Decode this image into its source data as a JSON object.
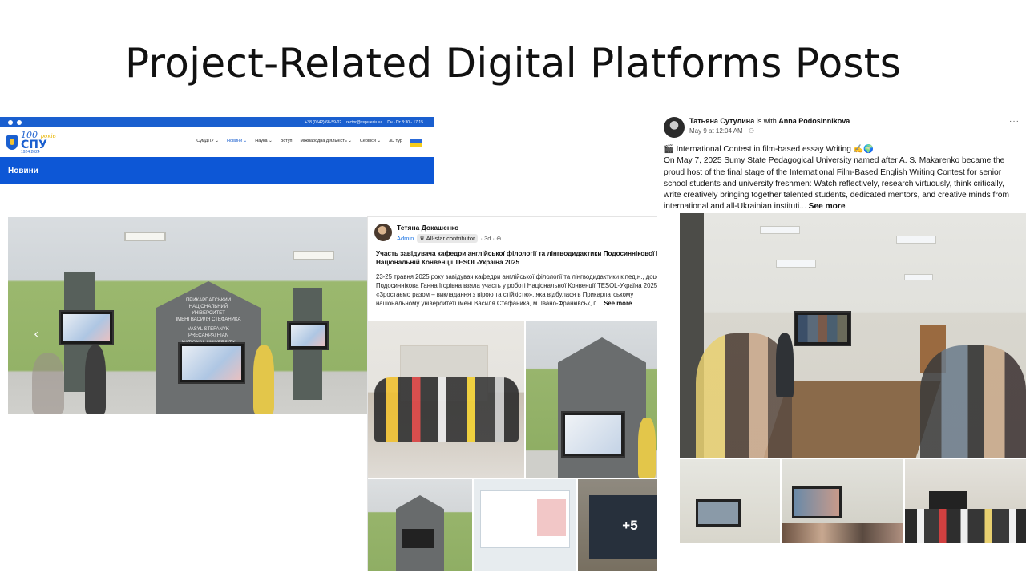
{
  "slide": {
    "title": "Project-Related Digital Platforms Posts"
  },
  "website": {
    "topbar_contacts": [
      "+38 (0542) 68-59-02",
      "rector@sspu.edu.ua",
      "Пн - Пт 8:30 - 17:15"
    ],
    "logo": {
      "hundred": "100",
      "years_word": "років",
      "abbr": "СПУ",
      "years_range": "1924 2024"
    },
    "nav": [
      {
        "label": "СумДПУ ⌄",
        "icon": "building-icon"
      },
      {
        "label": "Новини ⌄",
        "icon": "news-icon"
      },
      {
        "label": "Наука ⌄",
        "icon": "book-icon"
      },
      {
        "label": "Вступ",
        "icon": "person-icon"
      },
      {
        "label": "Міжнародна діяльність ⌄",
        "icon": "flag-icon"
      },
      {
        "label": "Сервіси ⌄",
        "icon": "cloud-icon"
      },
      {
        "label": "3D тур",
        "icon": "eye-icon"
      }
    ],
    "section_band": "Новини"
  },
  "left_photo": {
    "booth_text": [
      "ПРИКАРПАТСЬКИЙ",
      "НАЦІОНАЛЬНИЙ УНІВЕРСИТЕТ",
      "ІМЕНІ ВАСИЛЯ СТЕФАНИКА",
      "VASYL STEFANYK PRECARPATHIAN",
      "NATIONAL UNIVERSITY"
    ],
    "arrow": "‹"
  },
  "post_middle": {
    "author": "Тетяна Докашенко",
    "badge_admin": "Admin",
    "badge_star": "♛ All-star contributor",
    "time": "· 3d · ⊕",
    "more": "···",
    "title": "Участь завідувача кафедри англійської філології та лінгводидактики Подосиннікової Г.І. у Національній Конвенції TESOL-Україна 2025",
    "body": "23-25 травня 2025 року завідувач кафедри англійської філології та лінгводидактики к.пед.н., доцент Подосиннікова Ганна Ігорівна взяла участь у роботі Національної Конвенції TESOL-Україна 2025 «Зростаємо разом – викладання з вірою та стійкістю», яка відбулася в Прикарпатському національному університеті імені Василя Стефаника, м. Івано-Франківськ, п...",
    "see_more": "See more",
    "more_photos": "+5"
  },
  "post_right": {
    "author": "Татьяна Сутулина",
    "with_word": "is with",
    "tagged": "Anna Podosinnikova",
    "time": "May 9 at 12:04 AM · ⚇",
    "more": "···",
    "line1": "🎬 International Contest in film-based essay Writing ✍🌍",
    "body": "On May 7, 2025 Sumy State Pedagogical University named after A. S. Makarenko became the proud host of the final stage of the International Film-Based English Writing Contest for senior school students and university freshmen: Watch reflectively, research virtuously, think critically, write creatively bringing together talented students, dedicated mentors, and creative minds from international and all-Ukrainian instituti...",
    "see_more": "See more"
  },
  "colors": {
    "site_blue": "#0d57d6",
    "fb_blue": "#1b74e4"
  }
}
